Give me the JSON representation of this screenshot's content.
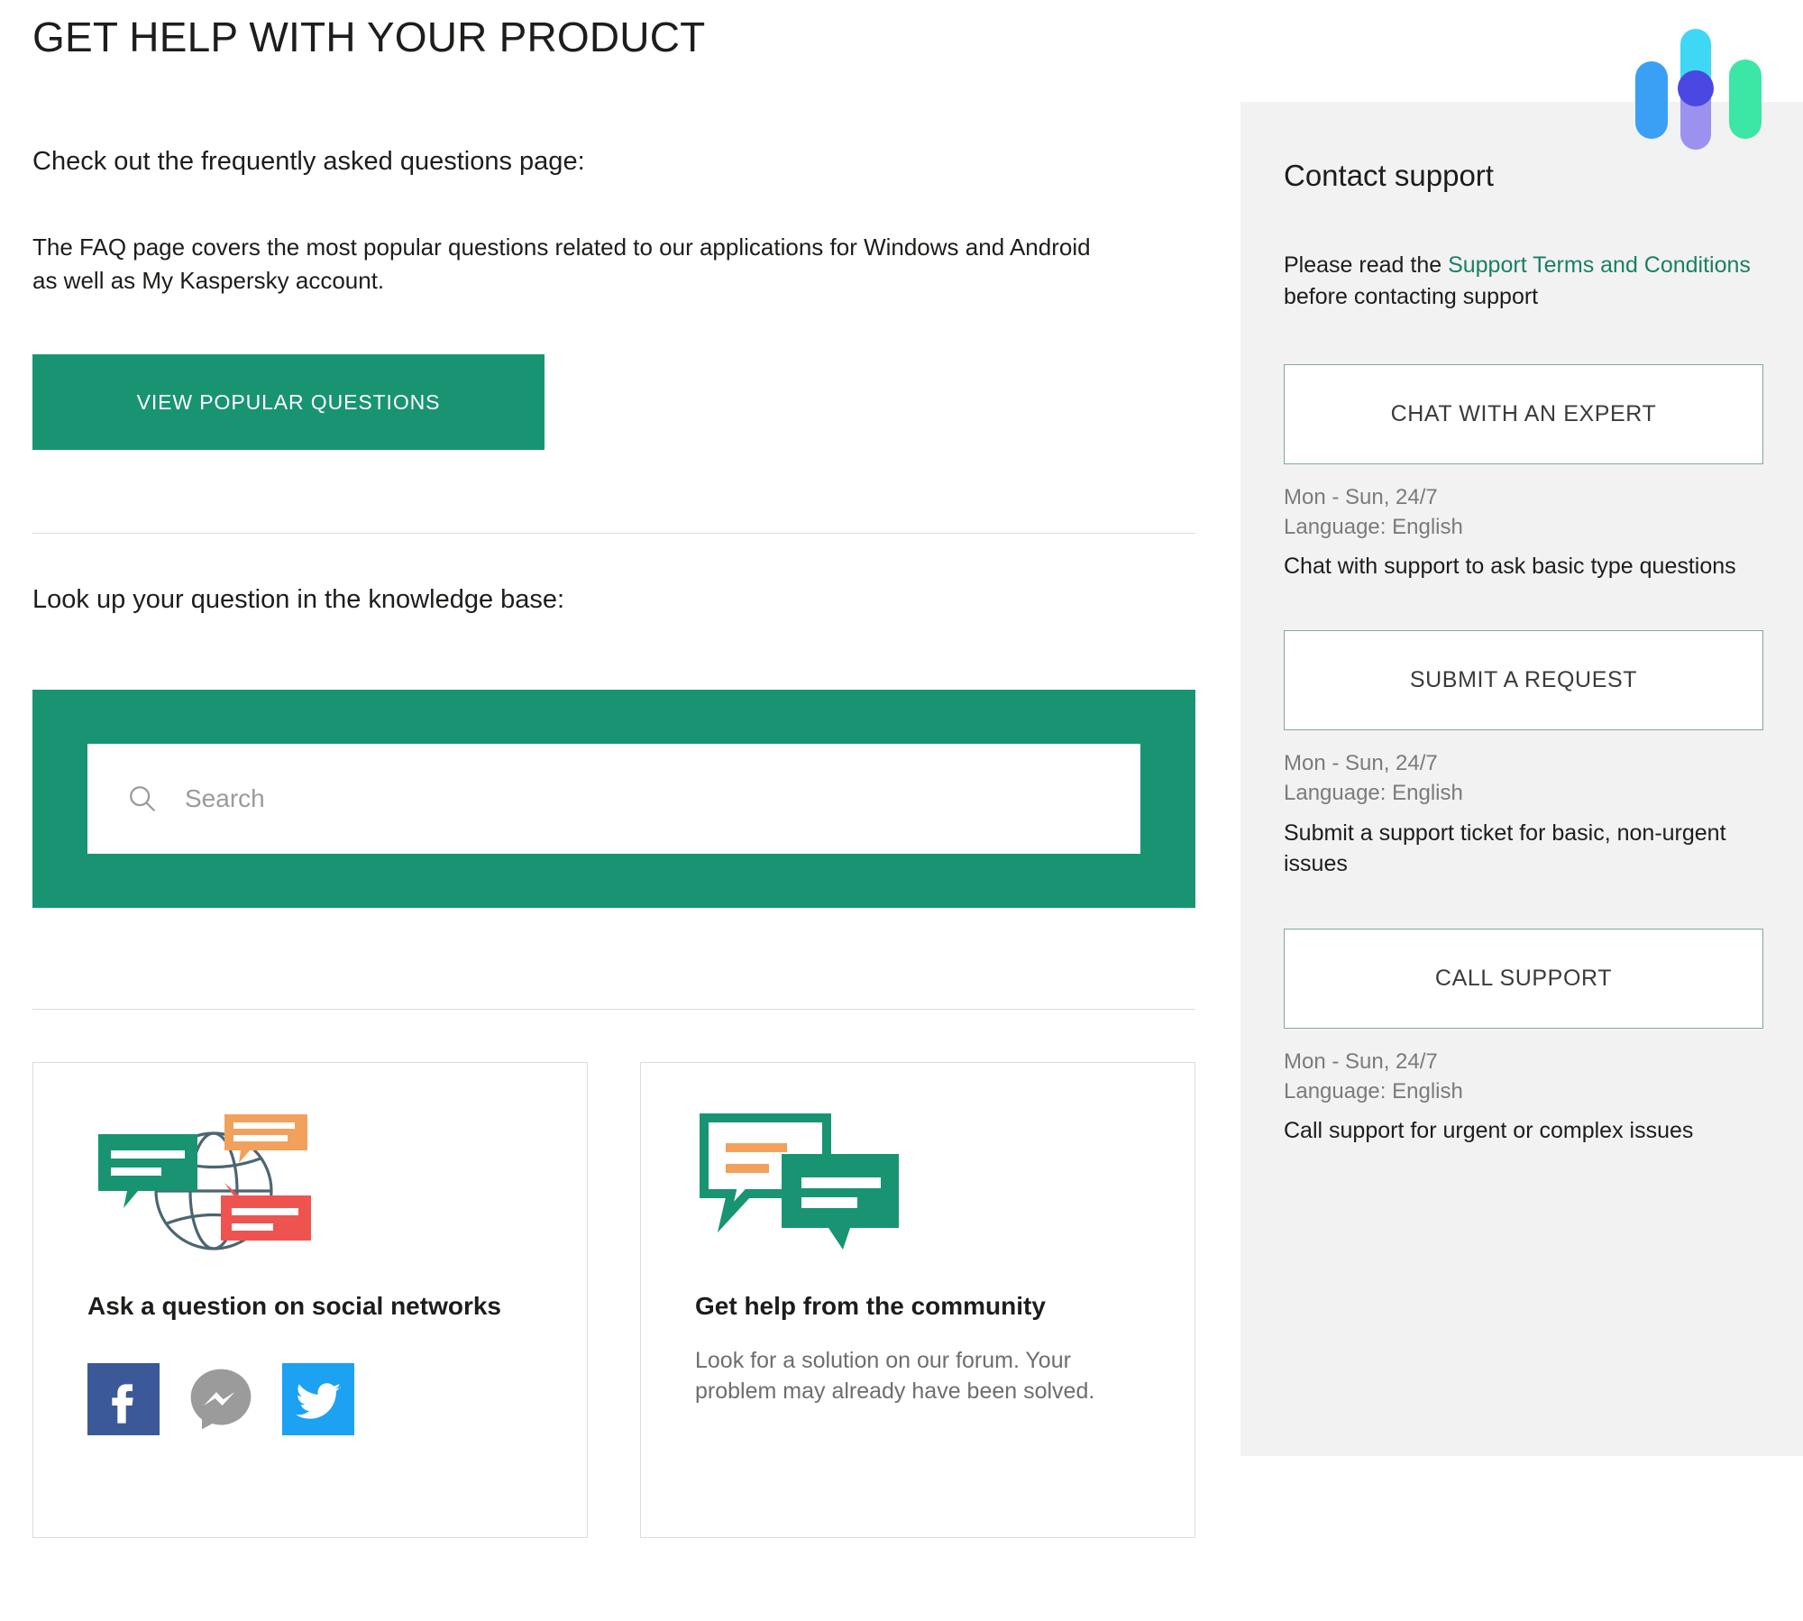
{
  "header": {
    "page_title": "GET HELP WITH YOUR PRODUCT",
    "logo_name": "brand-logo"
  },
  "faq": {
    "heading": "Check out the frequently asked questions page:",
    "body": "The FAQ page covers the most popular questions related to our applications for Windows and Android as well as My Kaspersky account.",
    "button_label": "VIEW POPULAR QUESTIONS"
  },
  "knowledge_base": {
    "heading": "Look up your question in the knowledge base:",
    "search_placeholder": "Search",
    "search_value": ""
  },
  "cards": [
    {
      "icon": "globe-chat-icon",
      "title": "Ask a question on social networks",
      "text": "",
      "socials": [
        {
          "name": "facebook-icon",
          "label": "Facebook"
        },
        {
          "name": "messenger-icon",
          "label": "Messenger"
        },
        {
          "name": "twitter-icon",
          "label": "Twitter"
        }
      ]
    },
    {
      "icon": "speech-bubbles-icon",
      "title": "Get help from the community",
      "text": "Look for a solution on our forum. Your problem may already have been solved.",
      "socials": []
    }
  ],
  "sidebar": {
    "title": "Contact support",
    "terms_prefix": "Please read the ",
    "terms_link": "Support Terms and Conditions",
    "terms_suffix": " before contacting support",
    "options": [
      {
        "button_label": "CHAT WITH AN EXPERT",
        "hours": "Mon - Sun, 24/7",
        "language": "Language: English",
        "description": "Chat with support to ask basic type questions"
      },
      {
        "button_label": "SUBMIT A REQUEST",
        "hours": "Mon - Sun, 24/7",
        "language": "Language: English",
        "description": "Submit a support ticket for basic, non-urgent issues"
      },
      {
        "button_label": "CALL SUPPORT",
        "hours": "Mon - Sun, 24/7",
        "language": "Language: English",
        "description": "Call support for urgent or complex issues"
      }
    ]
  },
  "colors": {
    "brand_green": "#199473",
    "link_green": "#1a7f64",
    "sidebar_bg": "#f2f2f2",
    "outline_border": "#7fa99c",
    "facebook_blue": "#3b5998",
    "messenger_gray": "#9b9b9b",
    "twitter_blue": "#1da1f2",
    "icon_orange": "#f2a15c",
    "icon_red": "#ef5350",
    "logo_blue": "#3aa0f5",
    "logo_cyan": "#3ed8f5",
    "logo_indigo": "#4a48e0",
    "logo_violet": "#9b92f0",
    "logo_green": "#3ce6a4"
  }
}
